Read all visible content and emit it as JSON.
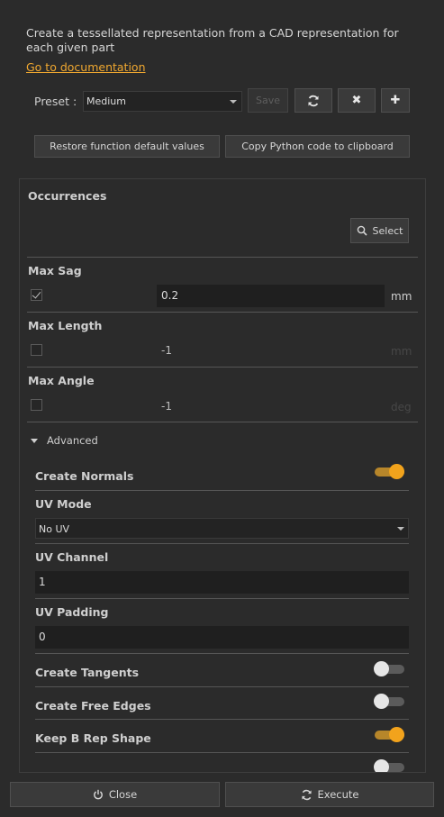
{
  "description": "Create a tessellated representation from a CAD representation for each given part",
  "doc_link": "Go to documentation",
  "preset": {
    "label": "Preset :",
    "value": "Medium",
    "save_label": "Save",
    "icons": [
      "refresh-icon",
      "delete-icon",
      "add-icon"
    ]
  },
  "actions": {
    "restore_label": "Restore function default values",
    "copy_label": "Copy Python code to clipboard"
  },
  "occurrences": {
    "title": "Occurrences",
    "select_label": "Select"
  },
  "max_sag": {
    "title": "Max Sag",
    "checked": true,
    "value": "0.2",
    "unit": "mm"
  },
  "max_length": {
    "title": "Max Length",
    "checked": false,
    "value": "-1",
    "unit": "mm"
  },
  "max_angle": {
    "title": "Max Angle",
    "checked": false,
    "value": "-1",
    "unit": "deg"
  },
  "advanced": {
    "label": "Advanced",
    "create_normals": {
      "title": "Create Normals",
      "on": true
    },
    "uv_mode": {
      "title": "UV Mode",
      "value": "No UV"
    },
    "uv_channel": {
      "title": "UV Channel",
      "value": "1"
    },
    "uv_padding": {
      "title": "UV Padding",
      "value": "0"
    },
    "create_tangents": {
      "title": "Create Tangents",
      "on": false
    },
    "create_free_edges": {
      "title": "Create Free Edges",
      "on": false
    },
    "keep_brep_shape": {
      "title": "Keep B Rep Shape",
      "on": true
    },
    "overwrite_tessellation": {
      "on": false
    }
  },
  "footer": {
    "close_label": "Close",
    "execute_label": "Execute"
  },
  "colors": {
    "accent": "#f2a31c",
    "background": "#2b2b2b",
    "link": "#f0a830"
  }
}
